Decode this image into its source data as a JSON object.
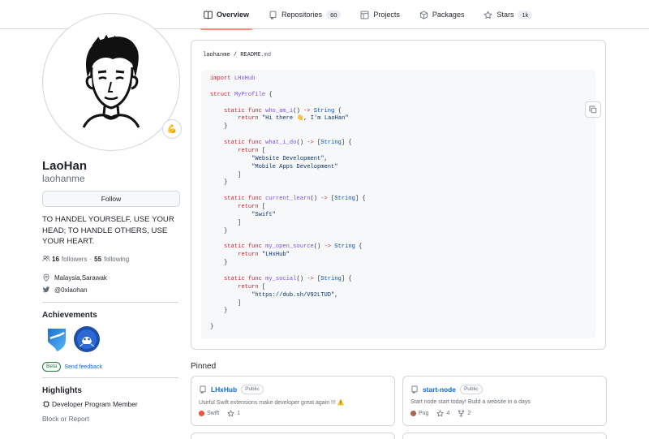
{
  "nav": {
    "tabs": [
      {
        "label": "Overview",
        "icon": "book-icon",
        "count": null,
        "active": true
      },
      {
        "label": "Repositories",
        "icon": "repo-icon",
        "count": "60",
        "active": false
      },
      {
        "label": "Projects",
        "icon": "table-icon",
        "count": null,
        "active": false
      },
      {
        "label": "Packages",
        "icon": "package-icon",
        "count": null,
        "active": false
      },
      {
        "label": "Stars",
        "icon": "star-icon",
        "count": "1k",
        "active": false
      }
    ]
  },
  "profile": {
    "name": "LaoHan",
    "login": "laohanme",
    "follow_label": "Follow",
    "status_emoji": "💪",
    "bio": "TO HANDEL YOURSELF, USE YOUR HEAD; TO HANDLE OTHERS, USE YOUR HEART.",
    "followers_count": "16",
    "followers_label": "followers",
    "separator": "·",
    "following_count": "55",
    "following_label": "following",
    "location": "Malaysia,Sarawak",
    "twitter": "@0xlaohan"
  },
  "achievements": {
    "title": "Achievements",
    "beta_label": "Beta",
    "feedback_label": "Send feedback"
  },
  "highlights": {
    "title": "Highlights",
    "item": "Developer Program Member",
    "report_label": "Block or Report"
  },
  "readme": {
    "owner": "laohanme",
    "slash": "/",
    "file": "README",
    "ext": ".md"
  },
  "pinned": {
    "title": "Pinned",
    "cards": [
      {
        "name": "LHxHub",
        "visibility": "Public",
        "description": "Useful Swift extensions make developer great again !!! ⚠️",
        "language": "Swift",
        "lang_color": "#F05138",
        "stars": "1",
        "forks": null
      },
      {
        "name": "start-node",
        "visibility": "Public",
        "description": "Start node start today! Build a website in a days",
        "language": "Pug",
        "lang_color": "#A86454",
        "stars": "4",
        "forks": "2"
      }
    ]
  }
}
